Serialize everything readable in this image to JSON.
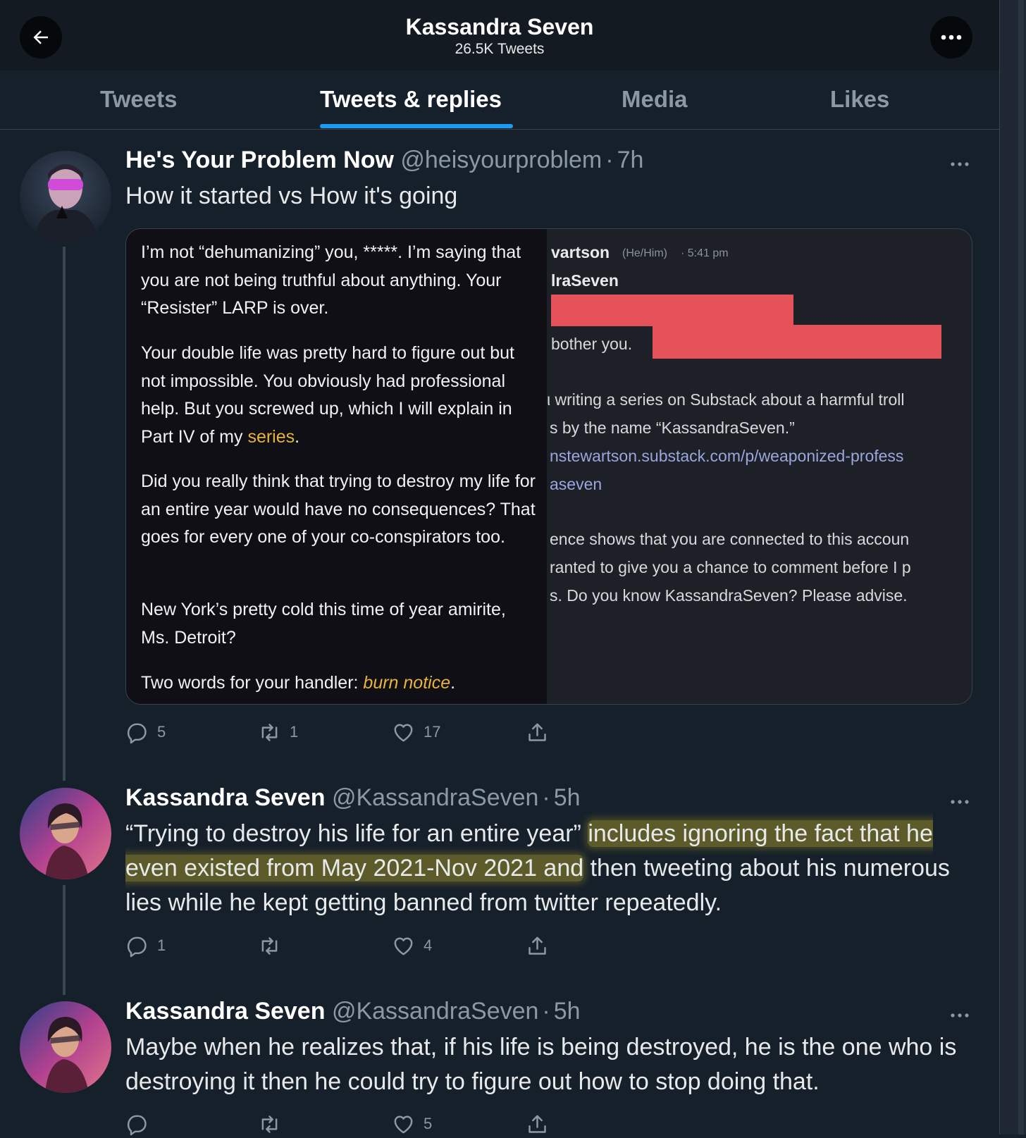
{
  "header": {
    "name": "Kassandra Seven",
    "tweet_count": "26.5K Tweets"
  },
  "tabs": [
    {
      "label": "Tweets"
    },
    {
      "label": "Tweets & replies"
    },
    {
      "label": "Media"
    },
    {
      "label": "Likes"
    }
  ],
  "tweets": [
    {
      "name": "He's Your Problem Now",
      "handle": "@heisyourproblem",
      "time": "7h",
      "text": "How it started vs How it's going",
      "replies": "5",
      "retweets": "1",
      "likes": "17"
    },
    {
      "name": "Kassandra Seven",
      "handle": "@KassandraSeven",
      "time": "5h",
      "text_before": "“Trying to destroy his life for an entire year” ",
      "text_highlighted": "includes ignoring the fact that he even existed from May 2021-Nov 2021 and",
      "text_after": " then tweeting about his numerous lies while he kept getting banned from twitter repeatedly.",
      "replies": "1",
      "retweets": "",
      "likes": "4"
    },
    {
      "name": "Kassandra Seven",
      "handle": "@KassandraSeven",
      "time": "5h",
      "text": "Maybe when he realizes that, if his life is being destroyed, he is the one who is destroying it then he could try to figure out how to stop doing that.",
      "replies": "",
      "retweets": "",
      "likes": "5"
    }
  ],
  "card": {
    "left": {
      "p1": "I’m not “dehumanizing” you, *****. I’m saying that you are not being truthful about anything. Your “Resister” LARP is over.",
      "p2_a": "Your double life was pretty hard to figure out but not impossible. You obviously had professional help. But you screwed up, which I will explain in Part IV of my ",
      "p2_link": "series",
      "p2_end": ".",
      "p3": "Did you really think that trying to destroy my life for an entire year would have no consequences? That goes for every one of your co-conspirators too.",
      "p4": "New York’s pretty cold this time of year amirite, Ms. Detroit?",
      "p5_a": "Two words for your handler: ",
      "p5_link": "burn notice",
      "p5_end": "."
    },
    "right": {
      "sender": "vartson",
      "pronouns": "(He/Him)",
      "time": "· 5:41 pm",
      "to": "lraSeven",
      "line_bother": "bother you.",
      "line1": "ι writing a series on Substack about a harmful troll",
      "line2": "s by the name “KassandraSeven.”",
      "link1": "nstewartson.substack.com/p/weaponized-profess",
      "link2": "aseven",
      "line3": "ence shows that you are connected to this accoun",
      "line4": "ranted to give you a chance to comment before I p",
      "line5": "s. Do you know KassandraSeven? Please advise."
    }
  },
  "colors": {
    "background": "#15202b",
    "accent": "#1d9bf0",
    "link_yellow": "#e6b33c",
    "redaction": "#e5525a",
    "highlight": "#9e9128"
  },
  "icons": [
    "arrow-left-icon",
    "more-icon",
    "reply-icon",
    "retweet-icon",
    "like-icon",
    "share-icon"
  ]
}
